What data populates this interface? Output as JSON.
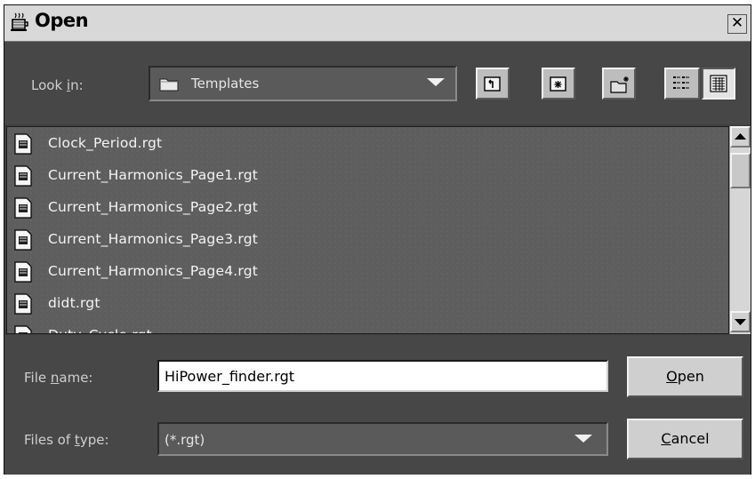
{
  "window": {
    "title": "Open"
  },
  "toolbar": {
    "look_in_label": "Look in:",
    "look_in_value": "Templates",
    "buttons": [
      "up-one-level",
      "home",
      "new-folder",
      "list-view",
      "details-view"
    ]
  },
  "files": [
    "Clock_Period.rgt",
    "Current_Harmonics_Page1.rgt",
    "Current_Harmonics_Page2.rgt",
    "Current_Harmonics_Page3.rgt",
    "Current_Harmonics_Page4.rgt",
    "didt.rgt",
    "Duty_Cycle.rgt"
  ],
  "form": {
    "file_name_label": "File name:",
    "file_name_value": "HiPower_finder.rgt",
    "files_of_type_label": "Files of type:",
    "files_of_type_value": "(*.rgt)"
  },
  "buttons": {
    "open": "Open",
    "cancel": "Cancel"
  },
  "colors": {
    "dialog_bg": "#474747",
    "list_bg": "#5e5e5e",
    "button_bg": "#cfcfcf"
  }
}
